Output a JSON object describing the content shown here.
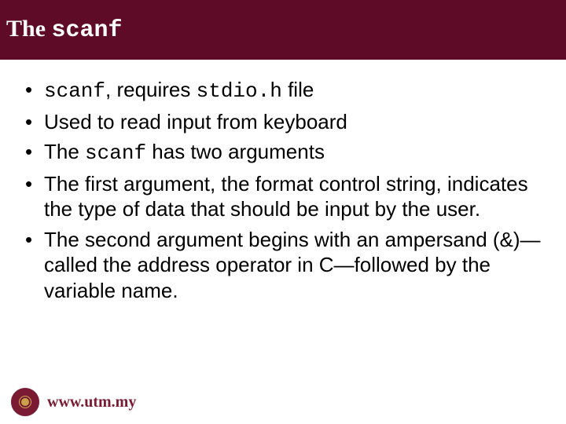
{
  "header": {
    "title_prefix": "The ",
    "title_code": "scanf"
  },
  "bullets": [
    {
      "pre": "",
      "code1": "scanf",
      "mid": ", requires ",
      "code2": "stdio.h",
      "post": " file"
    },
    {
      "pre": "Used to read input from keyboard",
      "code1": "",
      "mid": "",
      "code2": "",
      "post": ""
    },
    {
      "pre": "The ",
      "code1": "scanf",
      "mid": " has two arguments",
      "code2": "",
      "post": ""
    },
    {
      "pre": "The first argument, the format control string, indicates the type of data that should be input by the user.",
      "code1": "",
      "mid": "",
      "code2": "",
      "post": ""
    },
    {
      "pre": "The second argument begins with an ampersand (&)—called the address operator in C—followed by the variable name.",
      "code1": "",
      "mid": "",
      "code2": "",
      "post": ""
    }
  ],
  "footer": {
    "url": "www.utm.my"
  }
}
